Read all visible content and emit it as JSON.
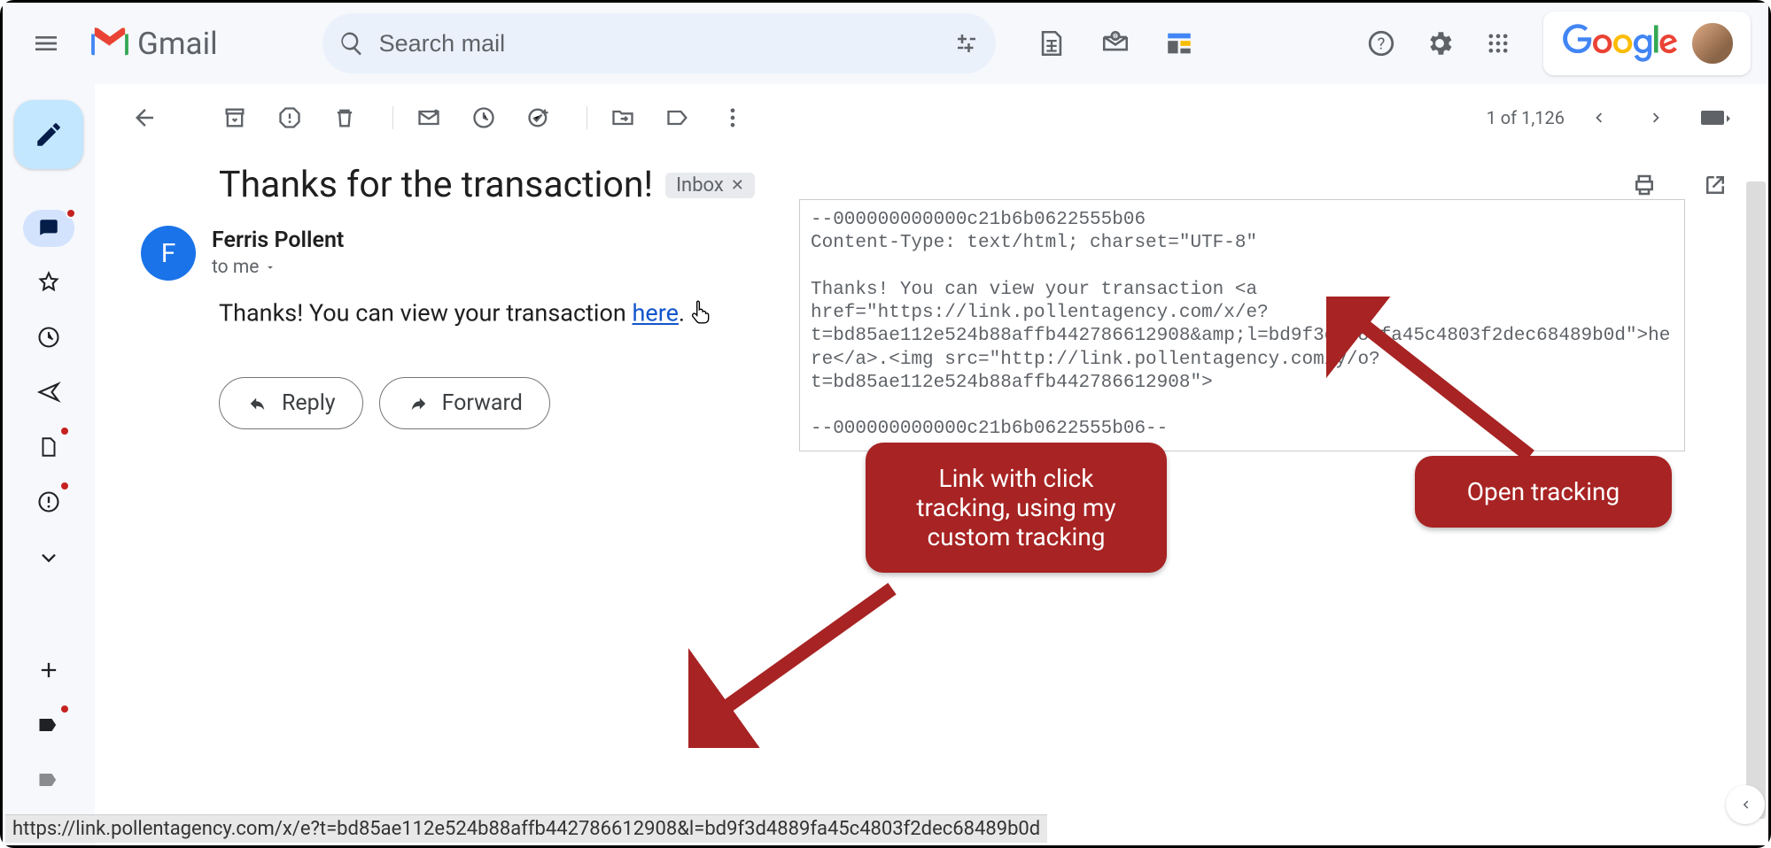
{
  "header": {
    "app_name": "Gmail",
    "search_placeholder": "Search mail",
    "google_logo_text": "Google"
  },
  "toolbar": {
    "pager_text": "1 of 1,126"
  },
  "message": {
    "subject": "Thanks for the transaction!",
    "label_chip": "Inbox",
    "sender_initial": "F",
    "sender_name": "Ferris Pollent",
    "to_line": "to me",
    "body_prefix": "Thanks! You can view your transaction ",
    "body_link_text": "here",
    "body_suffix": ".",
    "reply_label": "Reply",
    "forward_label": "Forward"
  },
  "raw_source": "--000000000000c21b6b0622555b06\nContent-Type: text/html; charset=\"UTF-8\"\n\nThanks! You can view your transaction <a href=\"https://link.pollentagency.com/x/e?t=bd85ae112e524b88affb442786612908&amp;l=bd9f3d4889fa45c4803f2dec68489b0d\">here</a>.<img src=\"http://link.pollentagency.com/y/o?t=bd85ae112e524b88affb442786612908\">\n\n--000000000000c21b6b0622555b06--",
  "annotations": {
    "click_tracking": "Link with click tracking, using my custom tracking",
    "open_tracking": "Open tracking"
  },
  "status_bar_url": "https://link.pollentagency.com/x/e?t=bd85ae112e524b88affb442786612908&l=bd9f3d4889fa45c4803f2dec68489b0d"
}
